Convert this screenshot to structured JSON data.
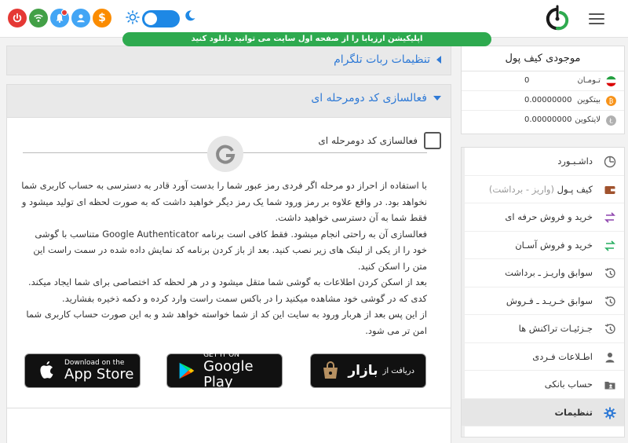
{
  "header": {
    "banner_text": "اپلیکیشن ارزیابا را از صفحه اول سایت می توانید دانلود کنید",
    "currency_symbol": "$",
    "icons": [
      "power-icon",
      "wifi-icon",
      "notification-icon",
      "user-icon",
      "dollar-icon",
      "sun-icon",
      "theme-toggle",
      "moon-icon"
    ]
  },
  "sections": {
    "telegram_title": "تنظیمات ربات تلگرام",
    "twofa_title": "فعالسازی کد دومرحله ای",
    "twofa_checkbox_label": "فعالسازی کد دومرحله ای",
    "twofa_checked": false
  },
  "description": {
    "p1": "با استفاده از احراز دو مرحله اگر فردی رمز عبور شما را بدست آورد قادر به دسترسی به حساب کاربری شما نخواهد بود. در واقع علاوه بر رمز ورود شما یک رمز دیگر خواهید داشت که به صورت لحظه ای تولید میشود و فقط شما به آن دسترسی خواهید داشت.",
    "p2": "فعالسازی آن به راحتی انجام میشود. فقط کافی است برنامه Google Authenticator متناسب با گوشی خود را از یکی از لینک های زیر نصب کنید. بعد از باز کردن برنامه کد نمایش داده شده در سمت راست این متن را اسکن کنید.",
    "p3": "بعد از اسکن کردن اطلاعات به گوشی شما متقل میشود و در هر لحظه کد اختصاصی برای شما ایجاد میکند. کدی که در گوشی خود مشاهده میکنید را در باکس سمت راست وارد کرده و دکمه ذخیره بفشارید.",
    "p4": "از این پس بعد از هربار ورود به سایت این کد از شما خواسته خواهد شد و به این صورت حساب کاربری شما امن تر می شود."
  },
  "badges": {
    "appstore_small": "Download on the",
    "appstore_big": "App Store",
    "googleplay_small": "GET IT ON",
    "googleplay_big": "Google Play",
    "bazaar_small": "دریافت از",
    "bazaar_big": "بازار"
  },
  "wallet": {
    "title": "موجودی کیف پول",
    "rows": [
      {
        "name": "تـومـان",
        "value": "0",
        "color": "#e53935"
      },
      {
        "name": "بیتکوین",
        "value": "0.00000000",
        "color": "#f7931a"
      },
      {
        "name": "لایتکوین",
        "value": "0.00000000",
        "color": "#b0b0b0"
      }
    ]
  },
  "menu": {
    "items": [
      {
        "label": "داشـبـورد",
        "sub": "",
        "icon": "dashboard-icon"
      },
      {
        "label": "کیف پـول",
        "sub": " (واریز - برداشت)",
        "icon": "wallet-icon"
      },
      {
        "label": "خرید و فروش حرفه ای",
        "sub": "",
        "icon": "exchange-pro-icon"
      },
      {
        "label": "خرید و فروش آسـان",
        "sub": "",
        "icon": "exchange-easy-icon"
      },
      {
        "label": "سوابق واریـز ـ برداشت",
        "sub": "",
        "icon": "history-icon"
      },
      {
        "label": "سوابق خـریـد ـ فـروش",
        "sub": "",
        "icon": "history-icon"
      },
      {
        "label": "جـزئیـات تراکنش ها",
        "sub": "",
        "icon": "history-icon"
      },
      {
        "label": "اطـلاعات فـردی",
        "sub": "",
        "icon": "person-icon"
      },
      {
        "label": "حساب بانکی",
        "sub": "",
        "icon": "bank-icon"
      },
      {
        "label": "تنظیمات",
        "sub": "",
        "icon": "settings-icon"
      }
    ]
  },
  "colors": {
    "primary": "#2f7ad6",
    "banner": "#2eaa4f",
    "accent_purple": "#8e44ad",
    "accent_green": "#27ae60"
  }
}
